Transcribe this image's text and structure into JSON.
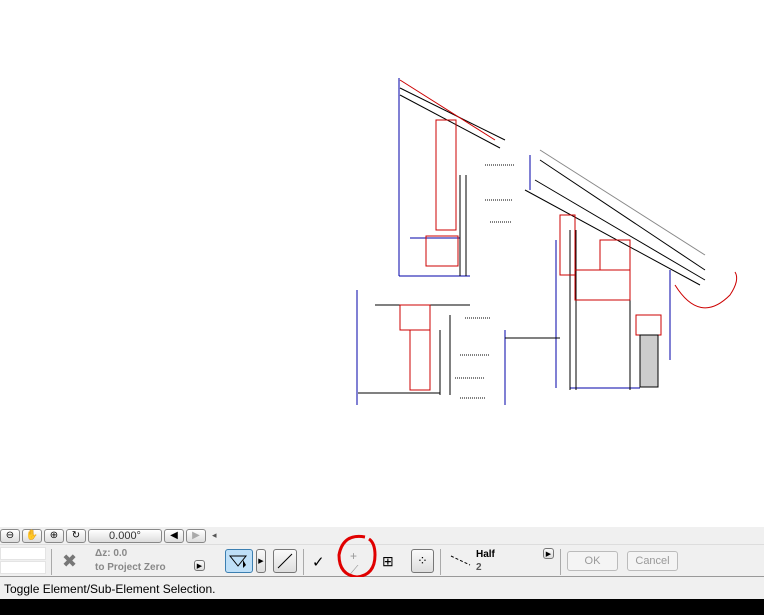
{
  "zoombar": {
    "angle": "0.000°"
  },
  "elevation": {
    "dz_label": "Δz:",
    "dz_value": "0.0",
    "reference": "to Project Zero"
  },
  "pen": {
    "label": "Half",
    "value": "2"
  },
  "buttons": {
    "ok": "OK",
    "cancel": "Cancel"
  },
  "status": {
    "message": "Toggle Element/Sub-Element Selection."
  },
  "colors": {
    "annotation": "#e00000",
    "section_line": "#0000aa",
    "cut_line": "#cc0000"
  }
}
